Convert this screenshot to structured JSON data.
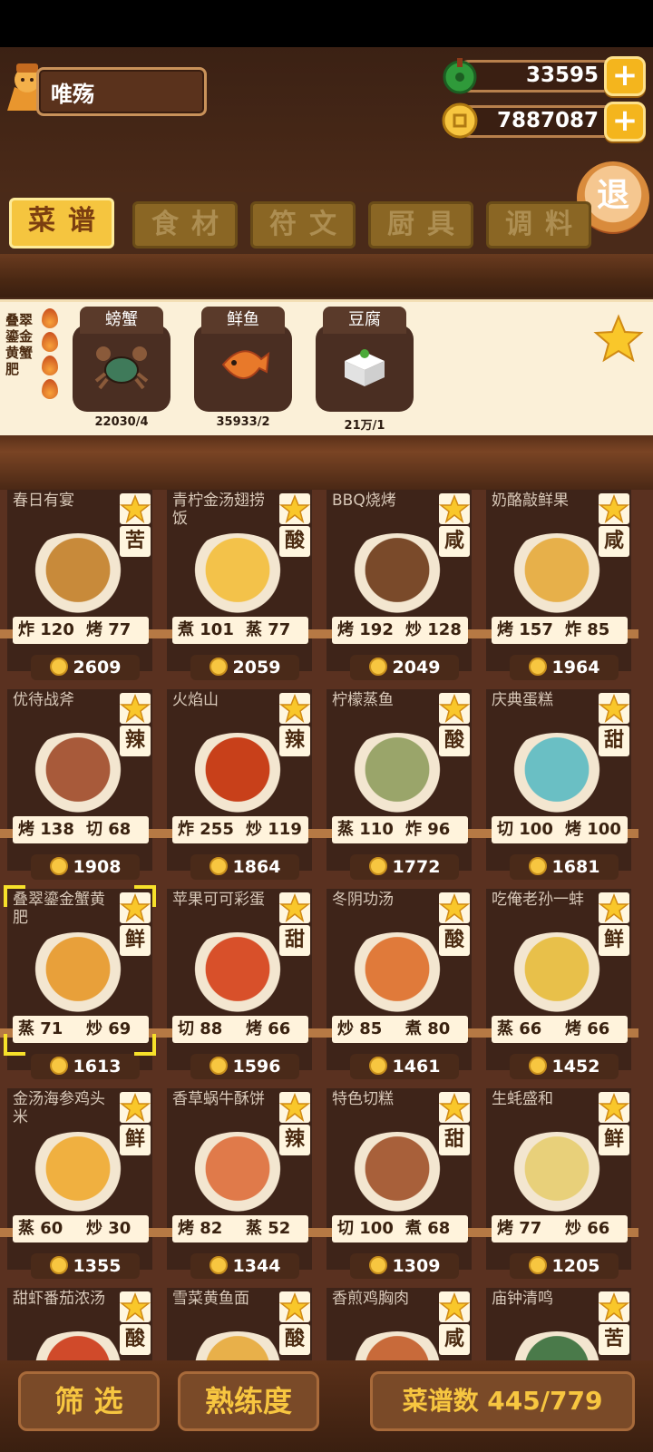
{
  "player": {
    "name": "唯殇"
  },
  "resources": {
    "jade": "33595",
    "coins": "7887087"
  },
  "exit_label": "退",
  "tabs": [
    {
      "label": "菜谱",
      "active": true
    },
    {
      "label": "食材",
      "active": false
    },
    {
      "label": "符文",
      "active": false
    },
    {
      "label": "厨具",
      "active": false
    },
    {
      "label": "调料",
      "active": false
    }
  ],
  "ingredient_panel": {
    "dish_name": "叠翠鎏金黄蟹肥",
    "items": [
      {
        "name": "螃蟹",
        "count": "22030/4",
        "icon": "crab-icon"
      },
      {
        "name": "鲜鱼",
        "count": "35933/2",
        "icon": "fish-icon"
      },
      {
        "name": "豆腐",
        "count": "21万/1",
        "icon": "tofu-icon"
      }
    ]
  },
  "recipes": [
    {
      "name": "春日有宴",
      "taste": "苦",
      "s1": "炸 120",
      "s2": "烤 77",
      "price": "2609"
    },
    {
      "name": "青柠金汤翅捞饭",
      "taste": "酸",
      "s1": "煮 101",
      "s2": "蒸 77",
      "price": "2059"
    },
    {
      "name": "BBQ烧烤",
      "taste": "咸",
      "s1": "烤 192",
      "s2": "炒 128",
      "price": "2049"
    },
    {
      "name": "奶酪敲鲜果",
      "taste": "咸",
      "s1": "烤 157",
      "s2": "炸 85",
      "price": "1964"
    },
    {
      "name": "优待战斧",
      "taste": "辣",
      "s1": "烤 138",
      "s2": "切 68",
      "price": "1908"
    },
    {
      "name": "火焰山",
      "taste": "辣",
      "s1": "炸 255",
      "s2": "炒 119",
      "price": "1864"
    },
    {
      "name": "柠檬蒸鱼",
      "taste": "酸",
      "s1": "蒸 110",
      "s2": "炸 96",
      "price": "1772"
    },
    {
      "name": "庆典蛋糕",
      "taste": "甜",
      "s1": "切 100",
      "s2": "烤 100",
      "price": "1681"
    },
    {
      "name": "叠翠鎏金蟹黄肥",
      "taste": "鲜",
      "s1": "蒸 71",
      "s2": "炒 69",
      "price": "1613"
    },
    {
      "name": "苹果可可彩蛋",
      "taste": "甜",
      "s1": "切 88",
      "s2": "烤 66",
      "price": "1596"
    },
    {
      "name": "冬阴功汤",
      "taste": "酸",
      "s1": "炒 85",
      "s2": "煮 80",
      "price": "1461"
    },
    {
      "name": "吃俺老孙一蚌",
      "taste": "鲜",
      "s1": "蒸 66",
      "s2": "烤 66",
      "price": "1452"
    },
    {
      "name": "金汤海参鸡头米",
      "taste": "鲜",
      "s1": "蒸 60",
      "s2": "炒 30",
      "price": "1355"
    },
    {
      "name": "香草蜗牛酥饼",
      "taste": "辣",
      "s1": "烤 82",
      "s2": "蒸 52",
      "price": "1344"
    },
    {
      "name": "特色切糕",
      "taste": "甜",
      "s1": "切 100",
      "s2": "煮 68",
      "price": "1309"
    },
    {
      "name": "生蚝盛和",
      "taste": "鲜",
      "s1": "烤 77",
      "s2": "炒 66",
      "price": "1205"
    },
    {
      "name": "甜虾番茄浓汤",
      "taste": "酸"
    },
    {
      "name": "雪菜黄鱼面",
      "taste": "酸"
    },
    {
      "name": "香煎鸡胸肉",
      "taste": "咸"
    },
    {
      "name": "庙钟清鸣",
      "taste": "苦"
    }
  ],
  "bottom": {
    "filter": "筛 选",
    "proficiency": "熟练度",
    "recipe_count": "菜谱数 445/779"
  }
}
